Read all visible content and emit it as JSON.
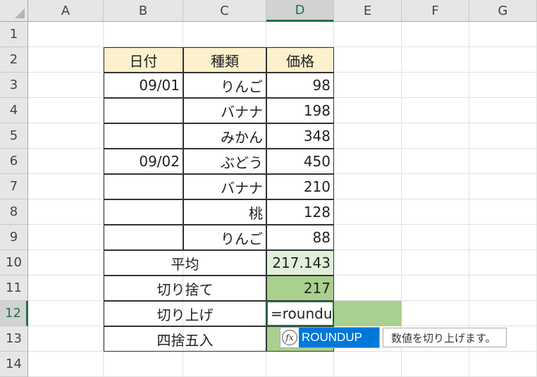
{
  "columns": [
    "A",
    "B",
    "C",
    "D",
    "E",
    "F",
    "G"
  ],
  "rows": [
    "1",
    "2",
    "3",
    "4",
    "5",
    "6",
    "7",
    "8",
    "9",
    "10",
    "11",
    "12",
    "13",
    "14"
  ],
  "active": {
    "column": "D",
    "row": "12"
  },
  "table": {
    "headers": {
      "date": "日付",
      "type": "種類",
      "price": "価格"
    },
    "rows": [
      {
        "date": "09/01",
        "type": "りんご",
        "price": "98"
      },
      {
        "date": "",
        "type": "バナナ",
        "price": "198"
      },
      {
        "date": "",
        "type": "みかん",
        "price": "348"
      },
      {
        "date": "09/02",
        "type": "ぶどう",
        "price": "450"
      },
      {
        "date": "",
        "type": "バナナ",
        "price": "210"
      },
      {
        "date": "",
        "type": "桃",
        "price": "128"
      },
      {
        "date": "",
        "type": "りんご",
        "price": "88"
      }
    ],
    "summary": [
      {
        "label": "平均",
        "value": "217.143"
      },
      {
        "label": "切り捨て",
        "value": "217"
      },
      {
        "label": "切り上げ",
        "value": ""
      },
      {
        "label": "四捨五入",
        "value": ""
      }
    ]
  },
  "editing": {
    "formula": "=roundup"
  },
  "autocomplete": {
    "icon": "fx-icon",
    "icon_text": "fx",
    "item": "ROUNDUP",
    "tooltip": "数値を切り上げます。"
  },
  "colors": {
    "header_fill": "#fdf0cc",
    "average_fill": "#e2efda",
    "result_fill": "#a9d08e",
    "selection": "#217346",
    "autocomplete_highlight": "#0078d7"
  }
}
